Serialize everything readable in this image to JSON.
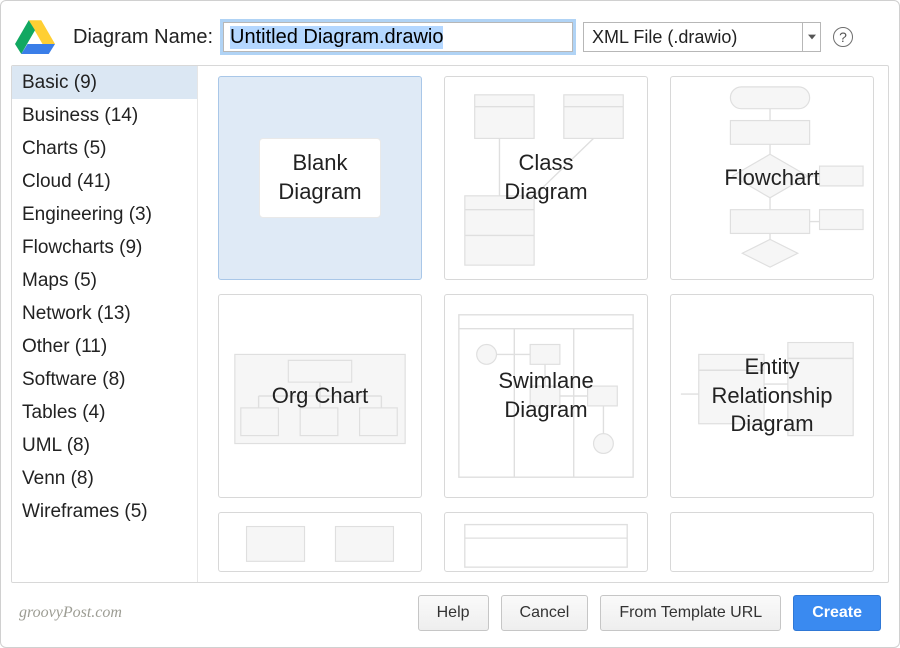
{
  "header": {
    "name_label": "Diagram Name:",
    "name_value": "Untitled Diagram.drawio",
    "extension_selected": "XML File (.drawio)",
    "help_glyph": "?"
  },
  "sidebar": {
    "selected_index": 0,
    "items": [
      {
        "label": "Basic (9)"
      },
      {
        "label": "Business (14)"
      },
      {
        "label": "Charts (5)"
      },
      {
        "label": "Cloud (41)"
      },
      {
        "label": "Engineering (3)"
      },
      {
        "label": "Flowcharts (9)"
      },
      {
        "label": "Maps (5)"
      },
      {
        "label": "Network (13)"
      },
      {
        "label": "Other (11)"
      },
      {
        "label": "Software (8)"
      },
      {
        "label": "Tables (4)"
      },
      {
        "label": "UML (8)"
      },
      {
        "label": "Venn (8)"
      },
      {
        "label": "Wireframes (5)"
      }
    ]
  },
  "templates": {
    "selected_index": 0,
    "tiles": [
      {
        "label": "Blank\nDiagram"
      },
      {
        "label": "Class\nDiagram"
      },
      {
        "label": "Flowchart"
      },
      {
        "label": "Org Chart"
      },
      {
        "label": "Swimlane\nDiagram"
      },
      {
        "label": "Entity\nRelationship\nDiagram"
      }
    ]
  },
  "footer": {
    "watermark": "groovyPost.com",
    "buttons": {
      "help": "Help",
      "cancel": "Cancel",
      "from_url": "From Template URL",
      "create": "Create"
    }
  }
}
